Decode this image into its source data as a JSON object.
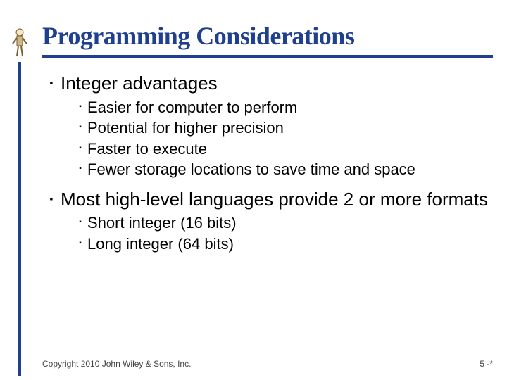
{
  "title": "Programming Considerations",
  "sections": [
    {
      "heading": "Integer advantages",
      "items": [
        "Easier for computer to perform",
        "Potential for higher precision",
        "Faster to execute",
        "Fewer storage locations to save time and space"
      ]
    },
    {
      "heading": "Most high-level languages provide 2 or more formats",
      "items": [
        "Short integer (16 bits)",
        "Long integer (64 bits)"
      ]
    }
  ],
  "footer": {
    "copyright": "Copyright 2010 John Wiley & Sons, Inc.",
    "page": "5 -*"
  },
  "bullet_glyph": "▪"
}
